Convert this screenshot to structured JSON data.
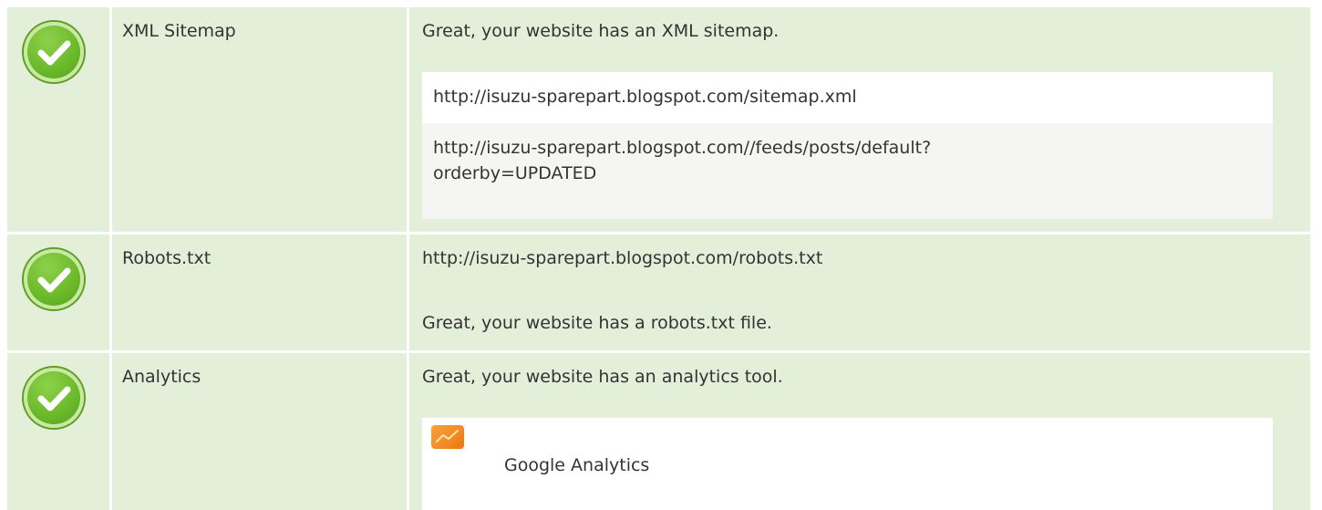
{
  "rows": [
    {
      "name": "XML Sitemap",
      "status_icon": "check-circle-icon",
      "message": "Great, your website has an XML sitemap.",
      "urls": [
        "http://isuzu-sparepart.blogspot.com/sitemap.xml",
        "http://isuzu-sparepart.blogspot.com//feeds/posts/default?orderby=UPDATED"
      ]
    },
    {
      "name": "Robots.txt",
      "status_icon": "check-circle-icon",
      "url": "http://isuzu-sparepart.blogspot.com/robots.txt",
      "message": "Great, your website has a robots.txt file."
    },
    {
      "name": "Analytics",
      "status_icon": "check-circle-icon",
      "message": "Great, your website has an analytics tool.",
      "tools": [
        {
          "name": "Google Analytics",
          "icon": "google-analytics-icon"
        }
      ]
    }
  ],
  "colors": {
    "row_background": "#e3efd9",
    "check_green": "#6ab92a",
    "analytics_orange": "#f28a22"
  }
}
